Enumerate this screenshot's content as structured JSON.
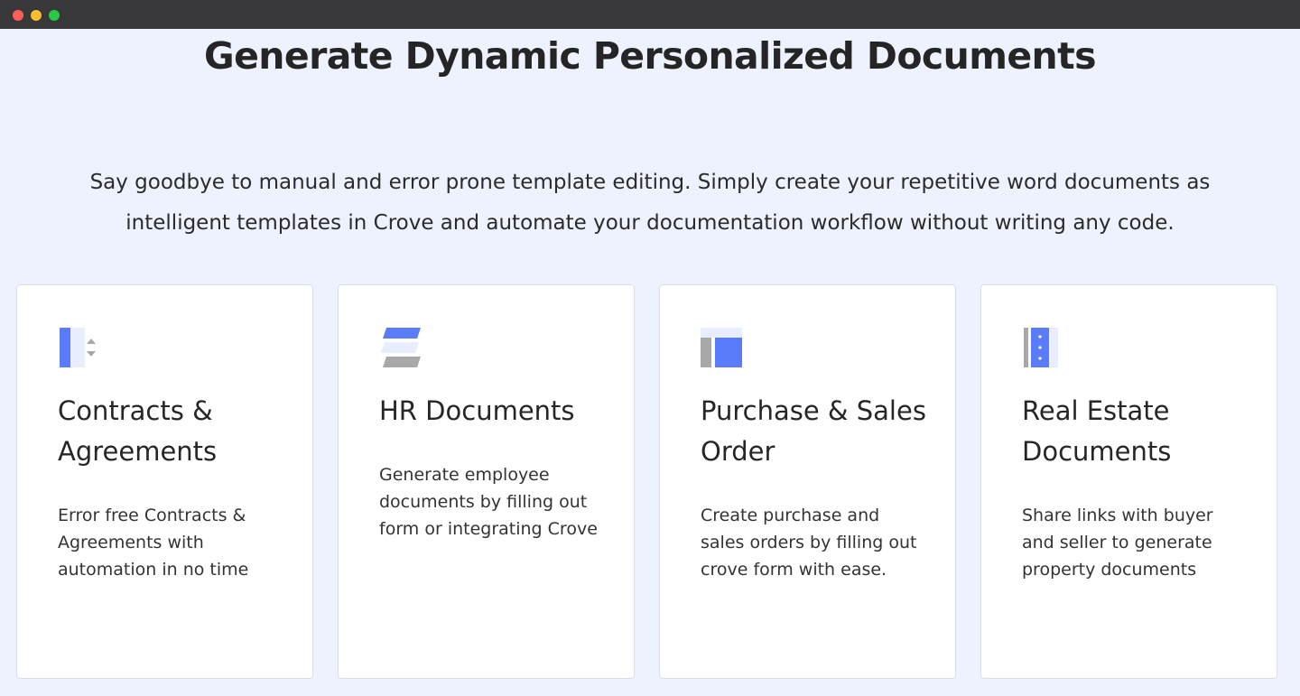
{
  "window": {
    "controls": [
      "close",
      "minimize",
      "maximize"
    ]
  },
  "hero": {
    "title": "Generate Dynamic Personalized Documents",
    "subtitle_line1": "Say goodbye to manual and error prone template editing. Simply create your repetitive word documents as",
    "subtitle_line2": "intelligent templates in Crove and automate your documentation workflow without writing any code."
  },
  "colors": {
    "accent_blue": "#5b7cfa",
    "light_blue": "#e8eefe",
    "gray": "#a8a8a8",
    "background": "#eef2fe"
  },
  "cards": [
    {
      "icon": "contracts-icon",
      "title": "Contracts & Agreements",
      "description": "Error free Contracts & Agreements with automation in no time"
    },
    {
      "icon": "hr-stack-icon",
      "title": "HR Documents",
      "description": "Generate employee documents by filling out form or integrating Crove"
    },
    {
      "icon": "layout-icon",
      "title": "Purchase & Sales Order",
      "description": "Create purchase and sales orders by filling out crove form with ease."
    },
    {
      "icon": "binder-icon",
      "title": "Real Estate Documents",
      "description": "Share links with buyer and seller to generate property documents"
    }
  ]
}
